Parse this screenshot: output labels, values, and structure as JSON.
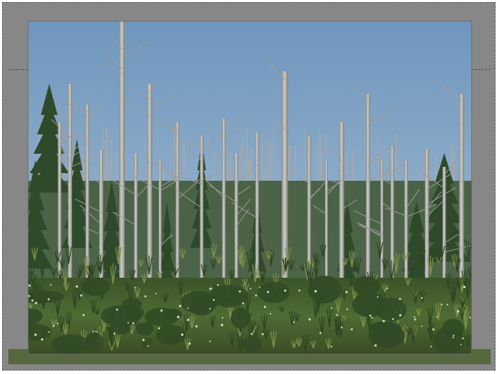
{
  "slide": {
    "background_color": "#ffffff",
    "frame_color": "#878787",
    "frame_band_color": "#55683f"
  },
  "photo": {
    "subject": "forest-dieback",
    "colors": {
      "sky_top": "#6f96bd",
      "sky_bottom": "#a9c1d6",
      "dead_trunk": "#b9b9b4",
      "dead_trunk_shadow": "#7d7d78",
      "conifer": "#2f4a2a",
      "undergrowth": "#4f6b33",
      "undergrowth_light": "#7c8f4c"
    }
  }
}
